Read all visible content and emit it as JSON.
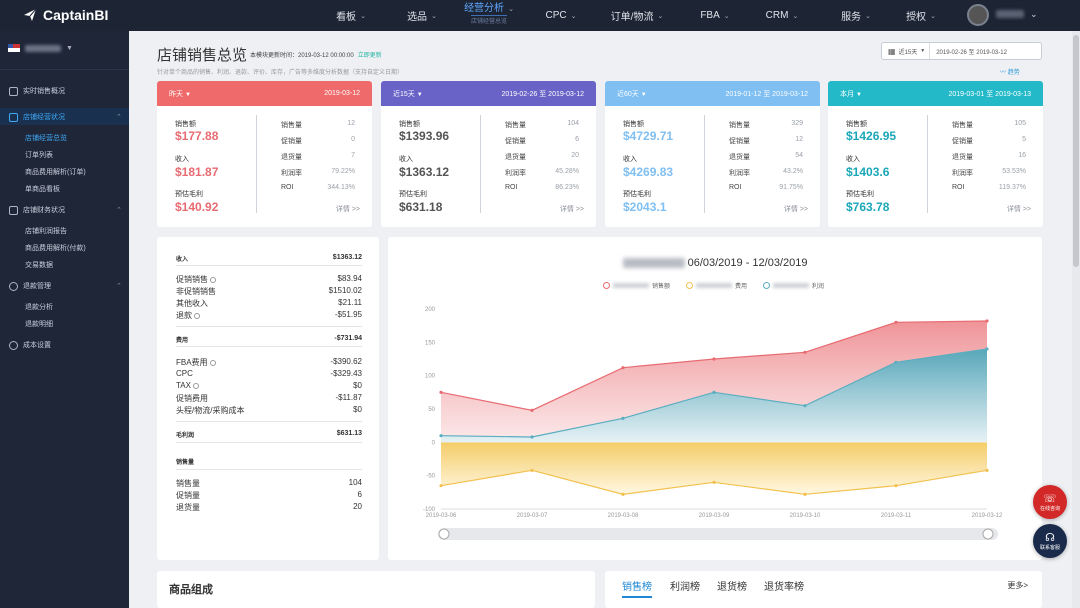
{
  "app": {
    "name": "CaptainBI"
  },
  "nav": [
    {
      "label": "看板"
    },
    {
      "label": "选品"
    },
    {
      "label": "经营分析",
      "sub": "店铺经营总览"
    },
    {
      "label": "CPC"
    },
    {
      "label": "订单/物流"
    },
    {
      "label": "FBA"
    },
    {
      "label": "CRM"
    },
    {
      "label": "服务"
    },
    {
      "label": "授权"
    }
  ],
  "sidebar": {
    "items": [
      {
        "label": "实时销售概况"
      },
      {
        "label": "店铺经营状况"
      },
      {
        "label": "店铺经营总览"
      },
      {
        "label": "订单列表"
      },
      {
        "label": "商品费用解析(订单)"
      },
      {
        "label": "单商品看板"
      },
      {
        "label": "店铺财务状况"
      },
      {
        "label": "店铺利润报告"
      },
      {
        "label": "商品费用解析(付款)"
      },
      {
        "label": "交易数据"
      },
      {
        "label": "退款管理"
      },
      {
        "label": "退款分析"
      },
      {
        "label": "退款明细"
      },
      {
        "label": "成本设置"
      }
    ]
  },
  "header": {
    "title": "店铺销售总览",
    "update_label": "本模块更新时间：2019-03-12 00:00:00",
    "update_link": "立即更新",
    "tip": "针对单个商品的销售、利润、退款、评价、库存，广告等多维度分析数据（支持自定义日期）",
    "date_preset": "近15天",
    "date_range": "2019-02-26 至 2019-03-12",
    "trend_label": "趋势"
  },
  "cards": [
    {
      "period": "昨天",
      "date": "2019-03-12",
      "color": "#ef6a6a",
      "sales_label": "销售额",
      "sales": "$177.88",
      "income_label": "收入",
      "income": "$181.87",
      "profit_label": "预估毛利",
      "profit": "$140.92",
      "stats": [
        [
          "销售量",
          "12"
        ],
        [
          "促销量",
          "0"
        ],
        [
          "退货量",
          "7"
        ],
        [
          "利润率",
          "79.22%"
        ],
        [
          "ROI",
          "344.13%"
        ]
      ],
      "detail": "详情 >>"
    },
    {
      "period": "近15天",
      "date": "2019-02-26 至 2019-03-12",
      "color": "#6a63c7",
      "sales_label": "销售额",
      "sales": "$1393.96",
      "income_label": "收入",
      "income": "$1363.12",
      "profit_label": "预估毛利",
      "profit": "$631.18",
      "stats": [
        [
          "销售量",
          "104"
        ],
        [
          "促销量",
          "6"
        ],
        [
          "退货量",
          "20"
        ],
        [
          "利润率",
          "45.28%"
        ],
        [
          "ROI",
          "86.23%"
        ]
      ],
      "detail": "详情 >>"
    },
    {
      "period": "近60天",
      "date": "2019-01-12 至 2019-03-12",
      "color": "#7fbff2",
      "sales_label": "销售额",
      "sales": "$4729.71",
      "income_label": "收入",
      "income": "$4269.83",
      "profit_label": "预估毛利",
      "profit": "$2043.1",
      "stats": [
        [
          "销售量",
          "329"
        ],
        [
          "促销量",
          "12"
        ],
        [
          "退货量",
          "54"
        ],
        [
          "利润率",
          "43.2%"
        ],
        [
          "ROI",
          "91.75%"
        ]
      ],
      "detail": "详情 >>"
    },
    {
      "period": "本月",
      "date": "2019-03-01 至 2019-03-13",
      "color": "#24b9c9",
      "sales_label": "销售额",
      "sales": "$1426.95",
      "income_label": "收入",
      "income": "$1403.6",
      "profit_label": "预估毛利",
      "profit": "$763.78",
      "stats": [
        [
          "销售量",
          "105"
        ],
        [
          "促销量",
          "5"
        ],
        [
          "退货量",
          "16"
        ],
        [
          "利润率",
          "53.53%"
        ],
        [
          "ROI",
          "119.37%"
        ]
      ],
      "detail": "详情 >>"
    }
  ],
  "breakdown": {
    "income": {
      "label": "收入",
      "value": "$1363.12"
    },
    "income_rows": [
      [
        "促销销售",
        "$83.94"
      ],
      [
        "非促销销售",
        "$1510.02"
      ],
      [
        "其他收入",
        "$21.11"
      ],
      [
        "退款",
        "-$51.95"
      ]
    ],
    "cost": {
      "label": "费用",
      "value": "-$731.94"
    },
    "cost_rows": [
      [
        "FBA费用",
        "-$390.62"
      ],
      [
        "CPC",
        "-$329.43"
      ],
      [
        "TAX",
        "$0"
      ],
      [
        "促销费用",
        "-$11.87"
      ],
      [
        "头程/物流/采购成本",
        "$0"
      ]
    ],
    "gross": {
      "label": "毛利润",
      "value": "$631.13"
    },
    "volume": {
      "label": "销售量"
    },
    "volume_rows": [
      [
        "销售量",
        "104"
      ],
      [
        "促销量",
        "6"
      ],
      [
        "退货量",
        "20"
      ]
    ]
  },
  "chart_header": {
    "title": "06/03/2019 - 12/03/2019",
    "legend": [
      "销售额",
      "费用",
      "利润"
    ]
  },
  "chart_data": {
    "type": "area",
    "title": "06/03/2019 - 12/03/2019",
    "x": [
      "2019-03-06",
      "2019-03-07",
      "2019-03-08",
      "2019-03-09",
      "2019-03-10",
      "2019-03-11",
      "2019-03-12"
    ],
    "series": [
      {
        "name": "销售额",
        "color": "#e86b72",
        "values": [
          75,
          48,
          112,
          125,
          135,
          180,
          182
        ]
      },
      {
        "name": "费用",
        "color": "#f2c14e",
        "values": [
          -65,
          -42,
          -78,
          -60,
          -78,
          -65,
          -42
        ]
      },
      {
        "name": "利润",
        "color": "#5aaec0",
        "values": [
          10,
          8,
          36,
          75,
          55,
          120,
          140
        ]
      }
    ],
    "ylim": [
      -100,
      200
    ],
    "yticks": [
      -100,
      -50,
      0,
      50,
      100,
      150,
      200
    ],
    "grid": false,
    "legend_position": "top"
  },
  "bottom": {
    "left_title": "商品组成",
    "tabs": [
      "销售榜",
      "利润榜",
      "退货榜",
      "退货率榜"
    ],
    "more": "更多>"
  },
  "float": {
    "a": "在线咨询",
    "b": "联系客服"
  }
}
